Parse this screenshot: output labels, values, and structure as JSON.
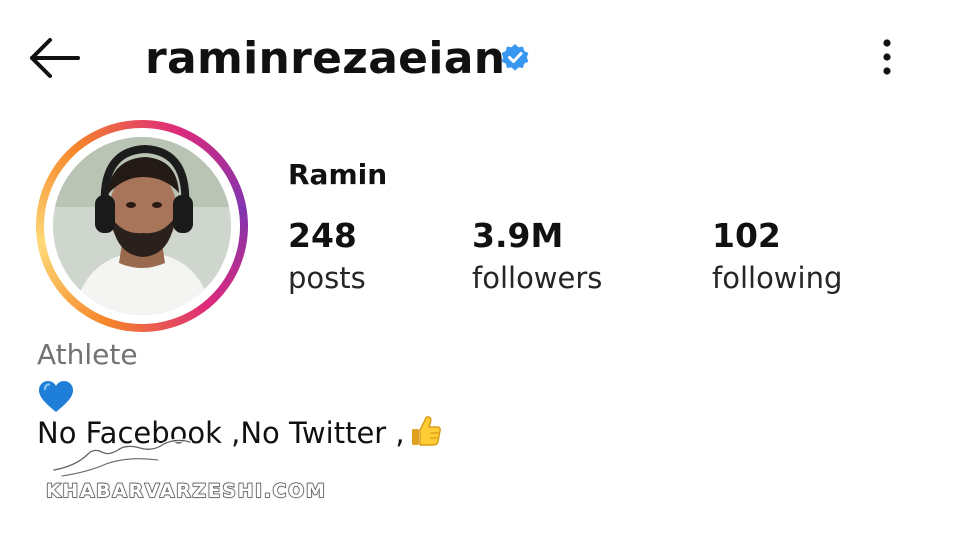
{
  "header": {
    "username": "raminrezaeian",
    "back_icon": "arrow-left-icon",
    "verified_icon": "verified-badge-icon",
    "more_icon": "more-vertical-icon"
  },
  "profile": {
    "display_name": "Ramin",
    "stats": {
      "posts": {
        "count": "248",
        "label": "posts"
      },
      "followers": {
        "count": "3.9M",
        "label": "followers"
      },
      "following": {
        "count": "102",
        "label": "following"
      }
    },
    "category": "Athlete",
    "bio_line1_icon": "blue-heart-emoji",
    "bio_line2": "No Facebook ,No Twitter ,",
    "bio_line2_icon": "thumbs-up-emoji"
  },
  "watermark": {
    "text": "KHABARVARZESHI.COM"
  },
  "colors": {
    "verified_blue": "#3897f0",
    "text_dark": "#111111",
    "category_gray": "#737373",
    "story_ring": [
      "#f58529",
      "#feda77",
      "#dd2a7b",
      "#8134af"
    ]
  }
}
